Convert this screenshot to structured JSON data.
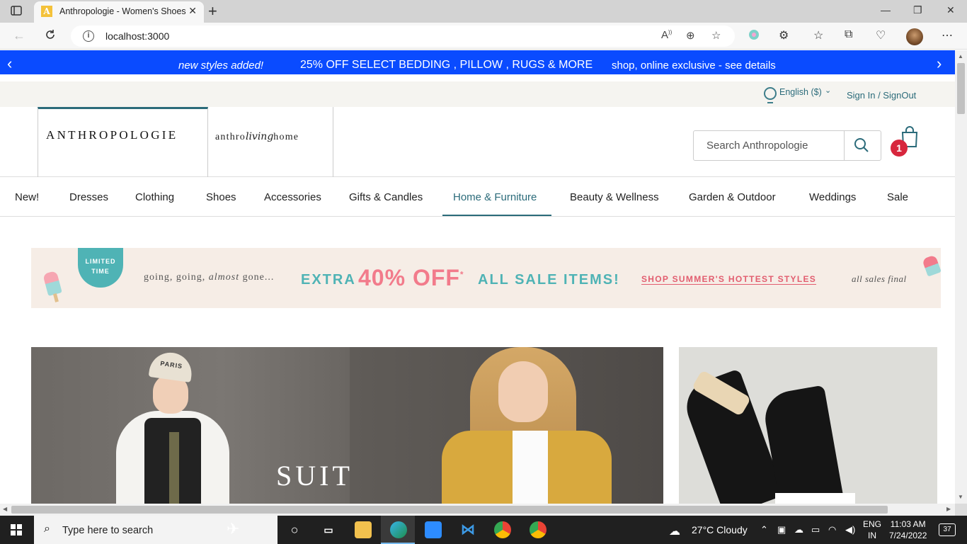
{
  "browser": {
    "tab_title": "Anthropologie - Women's Shoes",
    "tab_favicon": "A",
    "url": "localhost:3000",
    "new_tab": "+"
  },
  "promo": {
    "left_text": "new styles added!",
    "center_text": "25% OFF SELECT BEDDING , PILLOW , RUGS & MORE",
    "right_text": "shop, online exclusive - see details"
  },
  "utility": {
    "language": "English ($)",
    "signin": "Sign In / SignOut"
  },
  "header": {
    "logo": "ANTHROPOLOGIE",
    "living_a": "anthro",
    "living_b": "living",
    "living_c": "home",
    "search_placeholder": "Search Anthropologie",
    "cart_count": "1"
  },
  "menu": {
    "items": [
      "New!",
      "Dresses",
      "Clothing",
      "Shoes",
      "Accessories",
      "Gifts & Candles",
      "Home & Furniture",
      "Beauty & Wellness",
      "Garden & Outdoor",
      "Weddings",
      "Sale"
    ],
    "active": "Home & Furniture"
  },
  "sale_banner": {
    "badge_line1": "LIMITED",
    "badge_line2": "TIME",
    "going": "going, going,",
    "almost": "almost",
    "gone": "gone...",
    "extra": "EXTRA",
    "percent": "40% OFF",
    "star": "*",
    "all_sale": "ALL SALE ITEMS!",
    "shop_link": "SHOP SUMMER'S HOTTEST STYLES",
    "final": "all sales final"
  },
  "hero": {
    "title": "SUIT",
    "cap_text": "PARIS"
  },
  "taskbar": {
    "search_placeholder": "Type here to search",
    "weather": "27°C  Cloudy",
    "lang_line1": "ENG",
    "lang_line2": "IN",
    "time": "11:03 AM",
    "date": "7/24/2022",
    "notifications": "37"
  },
  "colors": {
    "promo_bg": "#0a4bff",
    "accent": "#2b6b7a",
    "badge": "#d7263d",
    "teal": "#4fb3b5",
    "pink": "#f27b8b"
  }
}
